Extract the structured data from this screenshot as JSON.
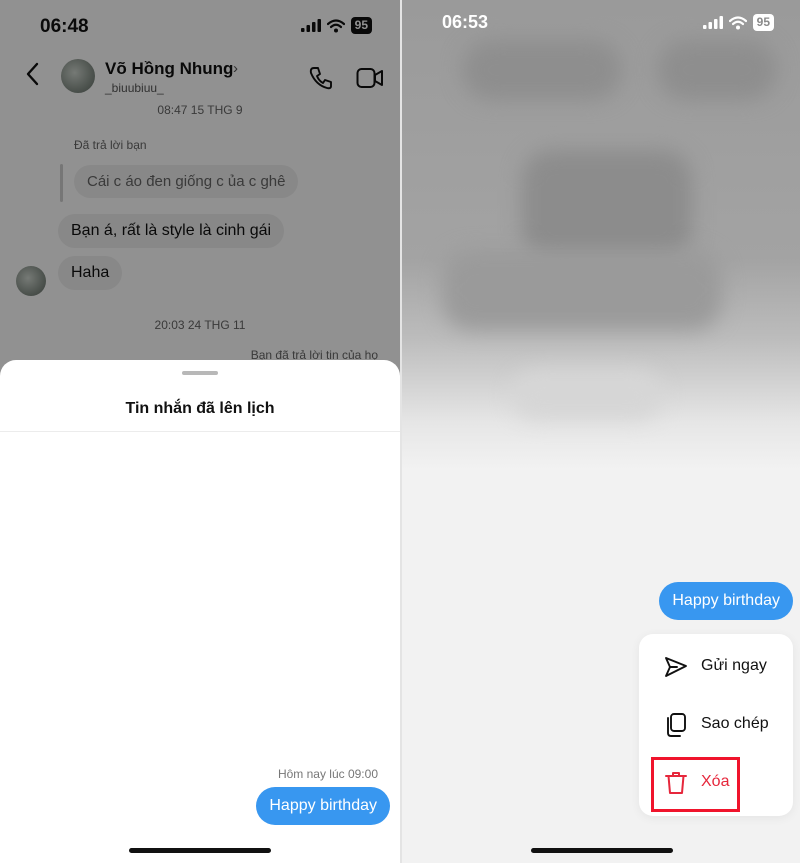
{
  "left": {
    "status": {
      "time": "06:48",
      "battery": "95"
    },
    "header": {
      "name": "Võ Hồng Nhung",
      "username": "_biuubiuu_"
    },
    "chat": {
      "timestamp1": "08:47 15 THG 9",
      "reply_label": "Đã trả lời bạn",
      "quoted_message": "Cái c áo đen giống c ủa c ghê",
      "message1": "Bạn á, rất là style là cinh gái",
      "message2": "Haha",
      "timestamp2": "20:03 24 THG 11",
      "reply_right": "Bạn đã trả lời tin của họ"
    },
    "sheet": {
      "title": "Tin nhắn đã lên lịch",
      "scheduled_time": "Hôm nay lúc 09:00",
      "scheduled_message": "Happy birthday"
    }
  },
  "right": {
    "status": {
      "time": "06:53",
      "battery": "95"
    },
    "message": "Happy birthday",
    "menu": {
      "send_now": "Gửi ngay",
      "copy": "Sao chép",
      "delete": "Xóa"
    },
    "colors": {
      "accent_blue": "#3897f0",
      "danger_red": "#e6273c",
      "highlight_red": "#f0142c"
    }
  }
}
